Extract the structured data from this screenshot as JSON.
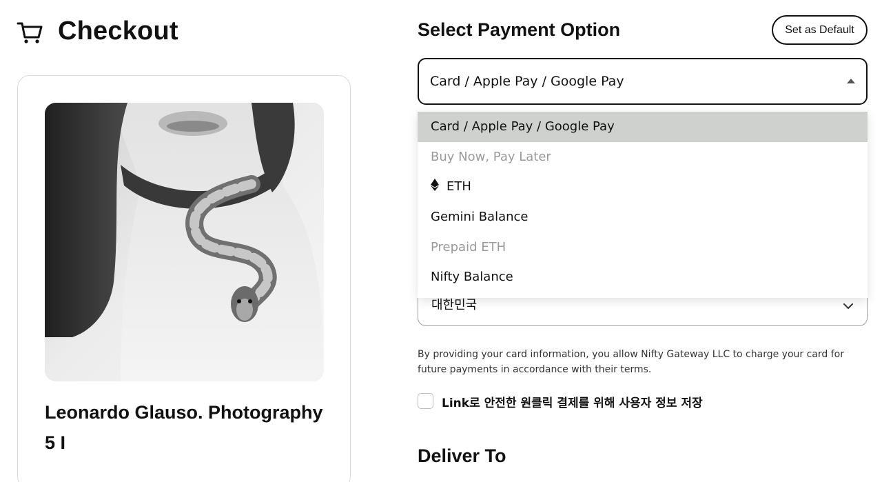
{
  "header": {
    "title": "Checkout",
    "icon": "cart-icon"
  },
  "product": {
    "title": "Leonardo Glauso. Photography 5 I",
    "image": "woman-with-snake-photo"
  },
  "payment": {
    "section_title": "Select Payment Option",
    "default_button": "Set as Default",
    "selected_value": "Card / Apple Pay / Google Pay",
    "options": [
      {
        "label": "Card / Apple Pay / Google Pay",
        "state": "selected"
      },
      {
        "label": "Buy Now, Pay Later",
        "state": "disabled"
      },
      {
        "label": "ETH",
        "state": "enabled",
        "icon": "eth-icon"
      },
      {
        "label": "Gemini Balance",
        "state": "enabled"
      },
      {
        "label": "Prepaid ETH",
        "state": "disabled"
      },
      {
        "label": "Nifty Balance",
        "state": "enabled"
      }
    ]
  },
  "country": {
    "value": "대한민국"
  },
  "consent": {
    "text": "By providing your card information, you allow Nifty Gateway LLC to charge your card for future payments in accordance with their terms."
  },
  "link_save": {
    "label": "Link로 안전한 원클릭 결제를 위해 사용자 정보 저장",
    "checked": false
  },
  "delivery": {
    "title": "Deliver To"
  },
  "colors": {
    "text": "#111111",
    "selected_option_bg": "#cfd1cf",
    "disabled_text": "#9a9a9a",
    "border": "#d9d9d9"
  }
}
